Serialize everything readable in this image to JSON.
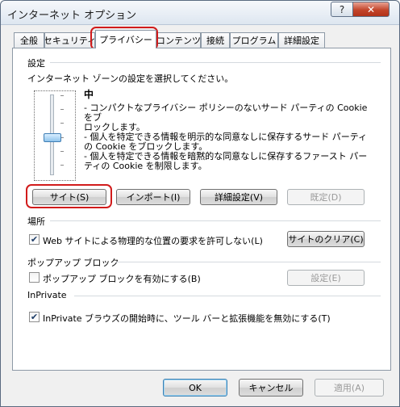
{
  "window": {
    "title": "インターネット オプション",
    "help_label": "?",
    "close_label": "✕"
  },
  "tabs": [
    {
      "label": "全般"
    },
    {
      "label": "セキュリティ"
    },
    {
      "label": "プライバシー",
      "active": true
    },
    {
      "label": "コンテンツ"
    },
    {
      "label": "接続"
    },
    {
      "label": "プログラム"
    },
    {
      "label": "詳細設定"
    }
  ],
  "settings": {
    "heading": "設定",
    "zone_prompt": "インターネット ゾーンの設定を選択してください。",
    "level": "中",
    "description": [
      "- コンパクトなプライバシー ポリシーのないサード パーティの Cookie をブ",
      "ロックします。",
      "- 個人を特定できる情報を明示的な同意なしに保存するサード パーティ",
      "の Cookie をブロックします。",
      "- 個人を特定できる情報を暗黙的な同意なしに保存するファースト パー",
      "ティの Cookie を制限します。"
    ],
    "buttons": {
      "sites": "サイト(S)",
      "import": "インポート(I)",
      "advanced": "詳細設定(V)",
      "default": "既定(D)"
    }
  },
  "location": {
    "heading": "場所",
    "checkbox_label": "Web サイトによる物理的な位置の要求を許可しない(L)",
    "checked": true,
    "clear_button": "サイトのクリア(C)"
  },
  "popup": {
    "heading": "ポップアップ ブロック",
    "checkbox_label": "ポップアップ ブロックを有効にする(B)",
    "checked": false,
    "settings_button": "設定(E)"
  },
  "inprivate": {
    "heading": "InPrivate",
    "checkbox_label": "InPrivate ブラウズの開始時に、ツール バーと拡張機能を無効にする(T)",
    "checked": true
  },
  "footer": {
    "ok": "OK",
    "cancel": "キャンセル",
    "apply": "適用(A)"
  },
  "colors": {
    "highlight": "#d11b1b",
    "check_mark": "#1e3d68"
  }
}
